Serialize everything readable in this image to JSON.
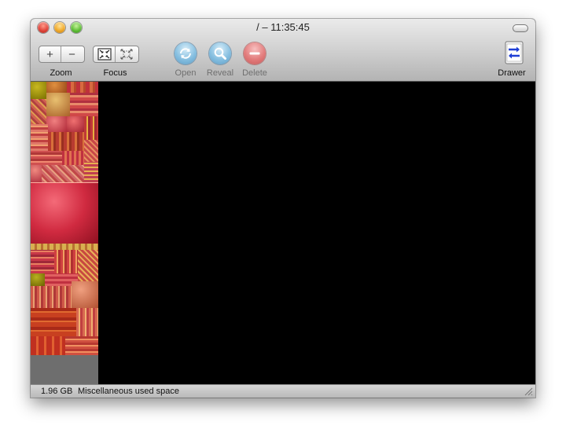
{
  "window": {
    "title": "/ – 11:35:45"
  },
  "toolbar": {
    "zoom": {
      "label": "Zoom",
      "in_glyph": "+",
      "out_glyph": "−",
      "in_icon": "zoom-in-icon",
      "out_icon": "zoom-out-icon"
    },
    "focus": {
      "label": "Focus",
      "in_icon": "focus-in-icon",
      "out_icon": "focus-out-icon"
    },
    "open": {
      "label": "Open",
      "icon": "open-icon",
      "enabled": false
    },
    "reveal": {
      "label": "Reveal",
      "icon": "magnifier-icon",
      "enabled": false
    },
    "delete": {
      "label": "Delete",
      "icon": "delete-icon",
      "enabled": false
    },
    "drawer": {
      "label": "Drawer",
      "icon": "drawer-toggle-icon"
    }
  },
  "colors": {
    "canvas": "#000000",
    "sidebar_bg": "#6e6e6e",
    "open_reveal_button": "#86bfe0",
    "delete_button": "#e27c7c",
    "treemap_palette": [
      "#c0303a",
      "#d4584a",
      "#b8682c",
      "#e0903a",
      "#9a9020",
      "#c84a50",
      "#e07a6a",
      "#a8202a"
    ]
  },
  "status": {
    "size": "1.96 GB",
    "description": "Miscellaneous used space"
  }
}
